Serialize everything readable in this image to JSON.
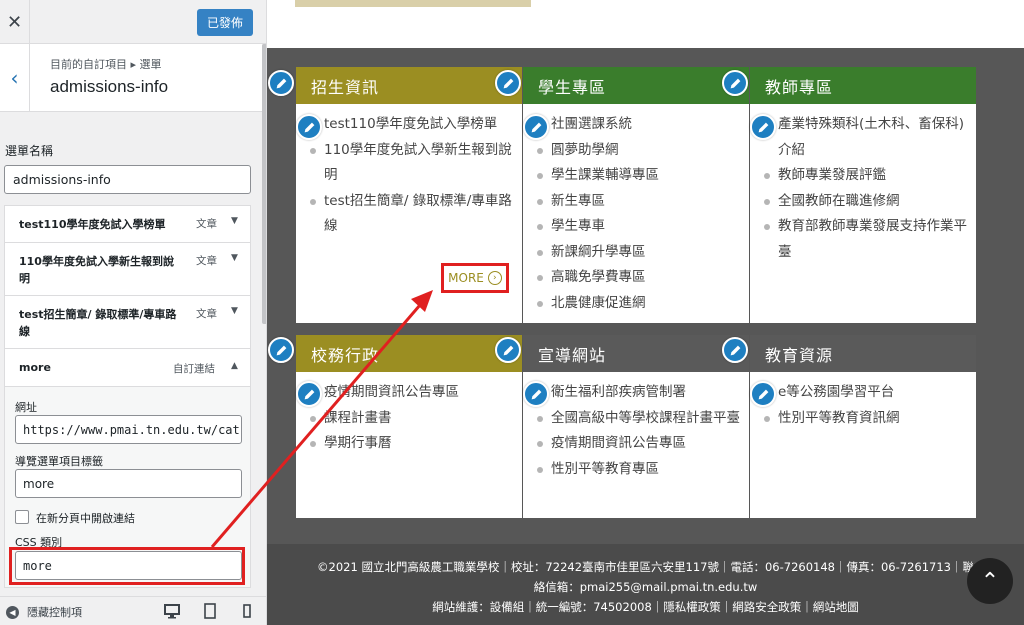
{
  "customizer": {
    "close_label": "✕",
    "publish_label": "已發佈",
    "breadcrumb": "目前的自訂項目 ▸ 選單",
    "title": "admissions-info",
    "menu_name_label": "選單名稱",
    "menu_name_value": "admissions-info",
    "items": [
      {
        "label": "test110學年度免試入學榜單",
        "type": "文章"
      },
      {
        "label": "110學年度免試入學新生報到說明",
        "type": "文章"
      },
      {
        "label": "test招生簡章/ 錄取標準/專車路線",
        "type": "文章"
      }
    ],
    "more_item": {
      "label": "more",
      "type": "自訂連結",
      "url_label": "網址",
      "url_value": "https://www.pmai.tn.edu.tw/cat",
      "nav_label_label": "導覽選單項目標籤",
      "nav_label_value": "more",
      "new_tab_label": "在新分頁中開啟連結",
      "css_label": "CSS 類別",
      "css_value": "more"
    },
    "hide_controls_label": "隱藏控制項"
  },
  "preview": {
    "sections": [
      {
        "title": "招生資訊",
        "color": "#9b8e22",
        "items": [
          "test110學年度免試入學榜單",
          "110學年度免試入學新生報到說明",
          "test招生簡章/ 錄取標準/專車路線"
        ]
      },
      {
        "title": "學生專區",
        "color": "#3a7d2c",
        "items": [
          "社團選課系統",
          "圓夢助學網",
          "學生課業輔導專區",
          "新生專區",
          "學生專車",
          "新課綱升學專區",
          "高職免學費專區",
          "北農健康促進網"
        ]
      },
      {
        "title": "教師專區",
        "color": "#3a7d2c",
        "items": [
          "產業特殊類科(土木科、畜保科)介紹",
          "教師專業發展評鑑",
          "全國教師在職進修網",
          "教育部教師專業發展支持作業平臺"
        ]
      },
      {
        "title": "校務行政",
        "color": "#9b8e22",
        "items": [
          "疫情期間資訊公告專區",
          "課程計畫書",
          "學期行事曆"
        ]
      },
      {
        "title": "宣導網站",
        "color": "#5a5a5a",
        "items": [
          "衛生福利部疾病管制署",
          "全國高級中等學校課程計畫平臺",
          "疫情期間資訊公告專區",
          "性別平等教育專區"
        ]
      },
      {
        "title": "教育資源",
        "color": "#5a5a5a",
        "items": [
          "e等公務園學習平台",
          "性別平等教育資訊網"
        ]
      }
    ],
    "more_label": "MORE",
    "footer": {
      "line1": "©2021 國立北門高級農工職業學校｜校址：72242臺南市佳里區六安里117號｜電話：06-7260148｜傳真：06-7261713｜聯",
      "line2": "絡信箱：pmai255@mail.pmai.tn.edu.tw",
      "line3": "網站維護：設備組｜統一編號：74502008｜隱私權政策｜網路安全政策｜網站地圖"
    },
    "to_top_icon": "double-chevron-up-icon"
  },
  "annotation_color": "#e02020"
}
